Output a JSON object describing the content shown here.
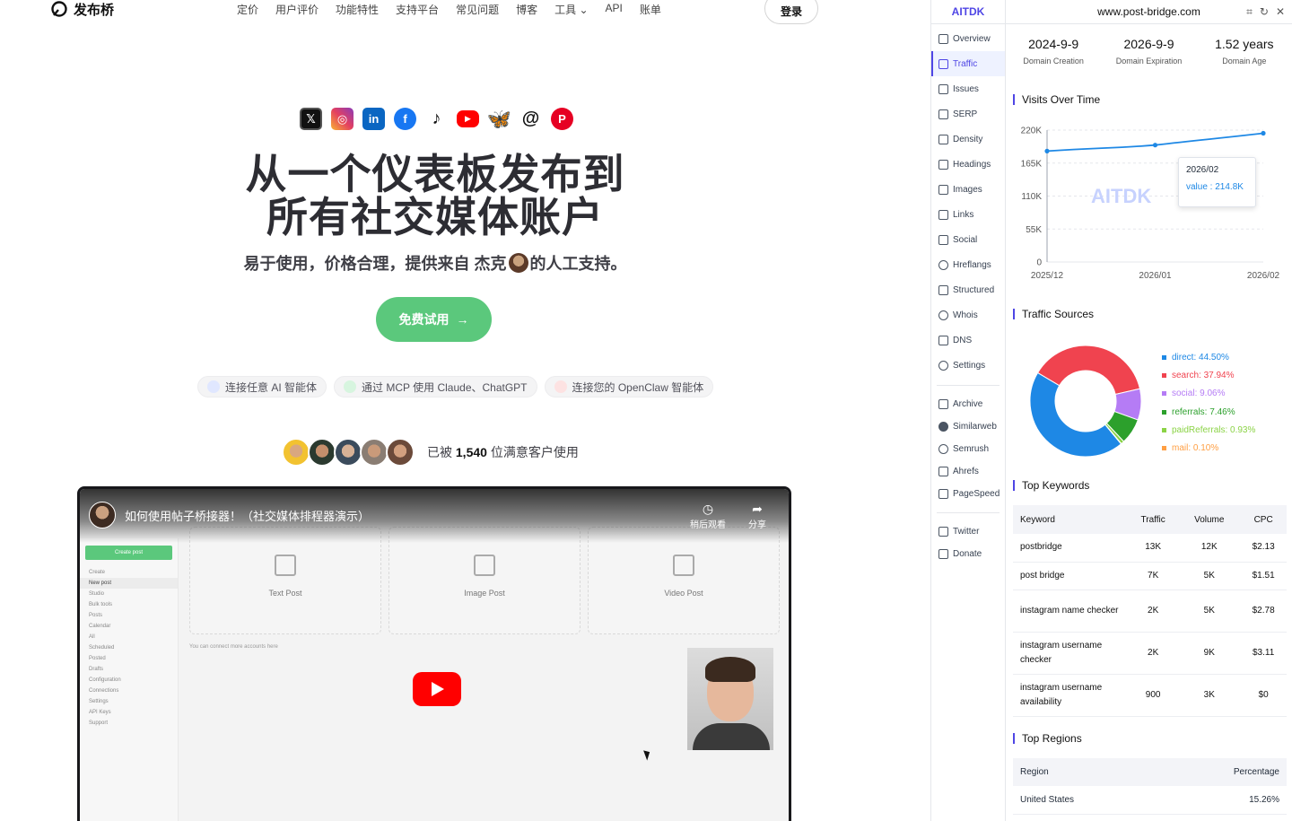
{
  "site": {
    "logo_text": "发布桥",
    "nav": [
      "定价",
      "用户评价",
      "功能特性",
      "支持平台",
      "常见问题",
      "博客",
      "工具",
      "API",
      "账单"
    ],
    "login_label": "登录",
    "social_icons": [
      "x-icon",
      "instagram-icon",
      "linkedin-icon",
      "facebook-icon",
      "tiktok-icon",
      "youtube-icon",
      "bluesky-icon",
      "threads-icon",
      "pinterest-icon"
    ],
    "hero_title_line1": "从一个仪表板发布到",
    "hero_title_line2": "所有社交媒体账户",
    "hero_sub_before": "易于使用，价格合理，提供来自 杰克",
    "hero_sub_after": "的人工支持。",
    "cta_label": "免费试用",
    "pills": [
      "连接任意 AI 智能体",
      "通过 MCP 使用 Claude、ChatGPT",
      "连接您的 OpenClaw 智能体"
    ],
    "users_prefix": "已被",
    "users_count": "1,540",
    "users_suffix": "位满意客户使用",
    "video": {
      "title": "如何使用帖子桥接器！（社交媒体排程器演示）",
      "watch_later": "稍后观看",
      "share": "分享",
      "sidebar_button": "Create post",
      "sidebar_items": [
        "Create",
        "New post",
        "Studio",
        "Bulk tools",
        "Posts",
        "Calendar",
        "All",
        "Scheduled",
        "Posted",
        "Drafts",
        "Configuration",
        "Connections",
        "Settings",
        "API Keys",
        "Support"
      ],
      "cards": [
        "Text Post",
        "Image Post",
        "Video Post"
      ],
      "note": "You can connect more accounts here"
    }
  },
  "aitdk": {
    "brand": "AITDK",
    "nav_items": [
      "Overview",
      "Traffic",
      "Issues",
      "SERP",
      "Density",
      "Headings",
      "Images",
      "Links",
      "Social",
      "Hreflangs",
      "Structured",
      "Whois",
      "DNS",
      "Settings"
    ],
    "active_item": "Traffic",
    "tool_items": [
      "Archive",
      "Similarweb",
      "Semrush",
      "Ahrefs",
      "PageSpeed"
    ],
    "footer_items": [
      "Twitter",
      "Donate"
    ],
    "domain": "www.post-bridge.com",
    "stats": [
      {
        "value": "2024-9-9",
        "label": "Domain Creation"
      },
      {
        "value": "2026-9-9",
        "label": "Domain Expiration"
      },
      {
        "value": "1.52 years",
        "label": "Domain Age"
      }
    ],
    "visits_title": "Visits Over Time",
    "watermark": "AITDK",
    "tooltip_date": "2026/02",
    "tooltip_value": "value : 214.8K",
    "sources_title": "Traffic Sources",
    "keywords_title": "Top Keywords",
    "keyword_headers": [
      "Keyword",
      "Traffic",
      "Volume",
      "CPC"
    ],
    "keywords": [
      [
        "postbridge",
        "13K",
        "12K",
        "$2.13"
      ],
      [
        "post bridge",
        "7K",
        "5K",
        "$1.51"
      ],
      [
        "instagram name checker",
        "2K",
        "5K",
        "$2.78"
      ],
      [
        "instagram username checker",
        "2K",
        "9K",
        "$3.11"
      ],
      [
        "instagram username availability",
        "900",
        "3K",
        "$0"
      ]
    ],
    "regions_title": "Top Regions",
    "region_headers": [
      "Region",
      "Percentage"
    ],
    "regions": [
      [
        "United States",
        "15.26%"
      ]
    ]
  },
  "chart_data": [
    {
      "type": "line",
      "title": "Visits Over Time",
      "x": [
        "2025/12",
        "2026/01",
        "2026/02"
      ],
      "series": [
        {
          "values": [
            185000,
            195000,
            214800
          ]
        }
      ],
      "yticks": [
        "220K",
        "165K",
        "110K",
        "55K",
        "0"
      ],
      "ylim": [
        0,
        220000
      ],
      "grid": true,
      "color": "#1e88e5"
    },
    {
      "type": "pie",
      "title": "Traffic Sources",
      "slices": [
        {
          "name": "direct",
          "value": 44.5,
          "label": "direct: 44.50%",
          "color": "#1e88e5"
        },
        {
          "name": "search",
          "value": 37.94,
          "label": "search: 37.94%",
          "color": "#f0434f"
        },
        {
          "name": "social",
          "value": 9.06,
          "label": "social: 9.06%",
          "color": "#b57cf5"
        },
        {
          "name": "referrals",
          "value": 7.46,
          "label": "referrals: 7.46%",
          "color": "#2ca02c"
        },
        {
          "name": "paidReferrals",
          "value": 0.93,
          "label": "paidReferrals: 0.93%",
          "color": "#8bd346"
        },
        {
          "name": "mail",
          "value": 0.1,
          "label": "mail: 0.10%",
          "color": "#ff9f43"
        }
      ]
    }
  ]
}
